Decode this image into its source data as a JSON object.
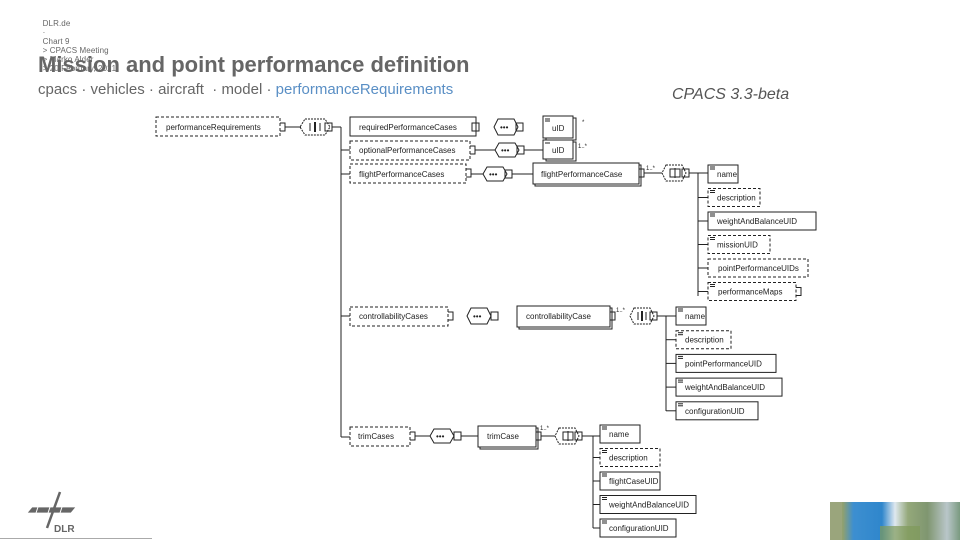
{
  "header": {
    "breadcrumb": [
      "DLR.de",
      "·",
      "Chart 9",
      "> CPACS Meeting",
      "> Marko Alder",
      "> 20 February, 2021"
    ],
    "title": "Mission and point performance definition",
    "path": [
      "cpacs",
      "vehicles",
      "aircraft",
      "model"
    ],
    "path_separator": "·",
    "path_highlight": "performanceRequirements",
    "version": "CPACS 3.3-beta"
  },
  "logo": {
    "text": "DLR"
  },
  "diagram": {
    "root": "performanceRequirements",
    "level1": {
      "required": "requiredPerformanceCases",
      "optional": "optionalPerformanceCases",
      "flight": "flightPerformanceCases",
      "controllability": "controllabilityCases",
      "trim": "trimCases"
    },
    "uid_label": "uID",
    "uid_required_card": "1..*",
    "uid_optional_card": "1..*",
    "flight_case": {
      "name": "flightPerformanceCase",
      "card": "1..*",
      "children": [
        "name",
        "description",
        "weightAndBalanceUID",
        "missionUID",
        "pointPerformanceUIDs",
        "performanceMaps"
      ]
    },
    "controllability_case": {
      "name": "controllabilityCase",
      "card": "1..*",
      "children": [
        "name",
        "description",
        "pointPerformanceUID",
        "weightAndBalanceUID",
        "configurationUID"
      ]
    },
    "trim_case": {
      "name": "trimCase",
      "card": "1..*",
      "children": [
        "name",
        "description",
        "flightCaseUID",
        "weightAndBalanceUID",
        "configurationUID"
      ]
    },
    "sequence_symbol": "•••"
  }
}
